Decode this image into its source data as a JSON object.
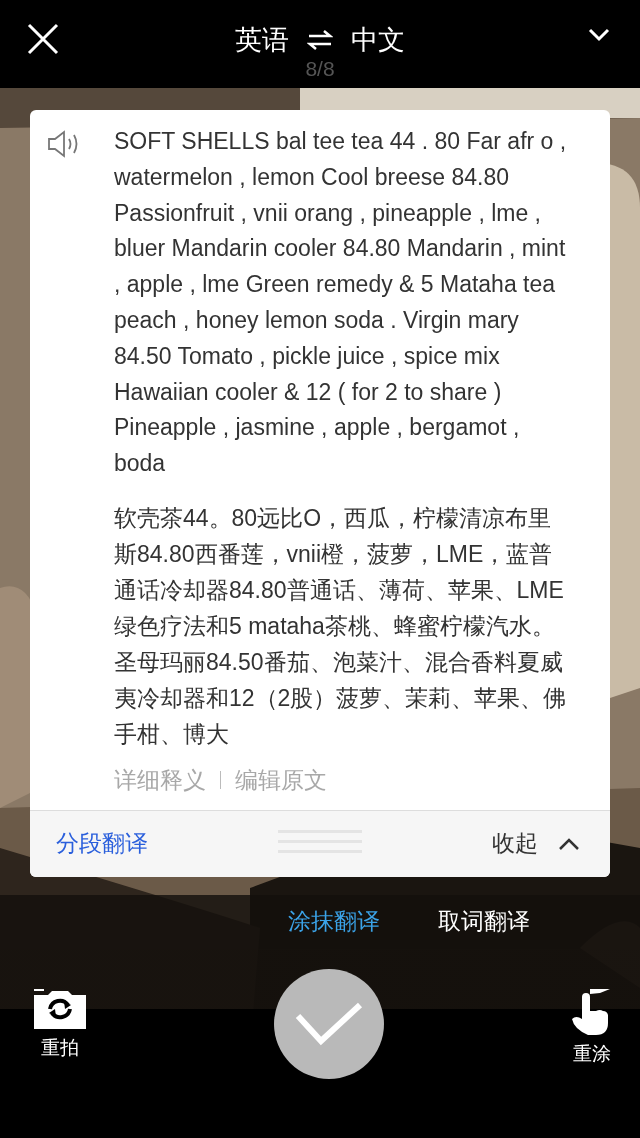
{
  "top_bar": {
    "source_language": "英语",
    "target_language": "中文",
    "page_counter": "8/8"
  },
  "result_card": {
    "source_text": "SOFT SHELLS bal tee tea 44 . 80 Far afr o , watermelon , lemon Cool breese 84.80 Passionfruit , vnii orang , pineapple , lme , bluer Mandarin cooler 84.80 Mandarin , mint , apple , lme Green remedy & 5 Mataha tea peach , honey lemon soda . Virgin mary 84.50 Tomato , pickle juice , spice mix Hawaiian cooler & 12 ( for 2 to share ) Pineapple , jasmine , apple , bergamot , boda",
    "translation": "软壳茶44。80远比O，西瓜，柠檬清凉布里斯84.80西番莲，vnii橙，菠萝，LME，蓝普通话冷却器84.80普通话、薄荷、苹果、LME绿色疗法和5 mataha茶桃、蜂蜜柠檬汽水。圣母玛丽84.50番茄、泡菜汁、混合香料夏威夷冷却器和12（2股）菠萝、茉莉、苹果、佛手柑、博大",
    "links": [
      "详细释义",
      "编辑原文"
    ],
    "segment_button": "分段翻译",
    "collapse_button": "收起"
  },
  "modes": [
    {
      "label": "涂抹翻译",
      "selected": true
    },
    {
      "label": "取词翻译",
      "selected": false
    }
  ],
  "actions": {
    "retake": "重拍",
    "repaint": "重涂"
  }
}
